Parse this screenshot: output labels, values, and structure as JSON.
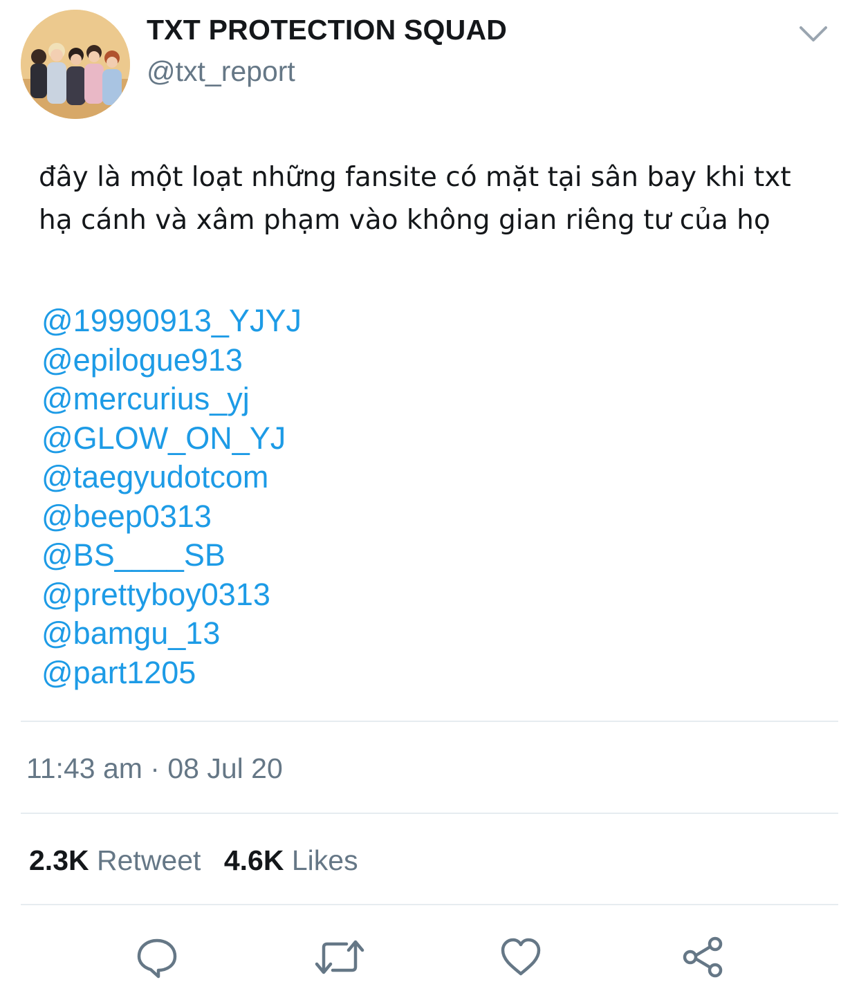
{
  "user": {
    "display_name": "TXT PROTECTION SQUAD",
    "handle": "@txt_report",
    "avatar_icon": "group-photo-avatar"
  },
  "tweet": {
    "text_lines": [
      "đây là một loạt những fansite có mặt tại sân bay khi txt",
      "hạ cánh và xâm phạm vào không gian riêng tư của họ"
    ],
    "mentions": [
      "@19990913_YJYJ",
      "@epilogue913",
      "@mercurius_yj",
      "@GLOW_ON_YJ",
      "@taegyudotcom",
      "@beep0313",
      "@BS____SB",
      "@prettyboy0313",
      "@bamgu_13",
      "@part1205"
    ],
    "timestamp": "11:43 am · 08 Jul 20"
  },
  "stats": {
    "retweets_count": "2.3K",
    "retweets_label": "Retweet",
    "likes_count": "4.6K",
    "likes_label": "Likes"
  },
  "actions": [
    "reply-icon",
    "retweet-icon",
    "like-icon",
    "share-icon"
  ],
  "colors": {
    "link": "#1d9be6",
    "secondary_text": "#657786",
    "primary_text": "#14171a",
    "divider": "#e6ecf0",
    "icon": "#657786"
  }
}
